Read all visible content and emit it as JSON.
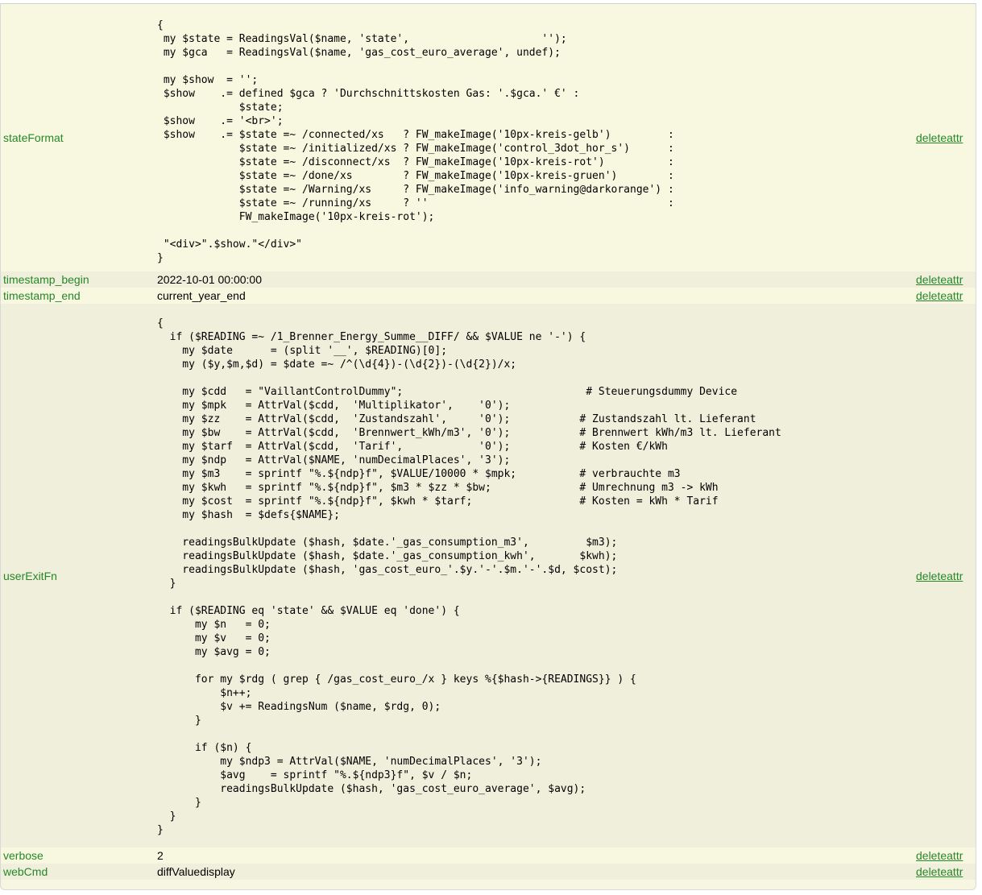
{
  "attributes": [
    {
      "name": "stateFormat",
      "action": "deleteattr",
      "code": "{\n my $state = ReadingsVal($name, 'state',                     '');\n my $gca   = ReadingsVal($name, 'gas_cost_euro_average', undef);\n\n my $show  = '';\n $show    .= defined $gca ? 'Durchschnittskosten Gas: '.$gca.' €' :\n             $state;\n $show    .= '<br>';\n $show    .= $state =~ /connected/xs   ? FW_makeImage('10px-kreis-gelb')         :\n             $state =~ /initialized/xs ? FW_makeImage('control_3dot_hor_s')      :\n             $state =~ /disconnect/xs  ? FW_makeImage('10px-kreis-rot')          :\n             $state =~ /done/xs        ? FW_makeImage('10px-kreis-gruen')        :\n             $state =~ /Warning/xs     ? FW_makeImage('info_warning@darkorange') :\n             $state =~ /running/xs     ? ''                                      :\n             FW_makeImage('10px-kreis-rot');\n\n \"<div>\".$show.\"</div>\"\n}"
    },
    {
      "name": "timestamp_begin",
      "action": "deleteattr",
      "value": "2022-10-01 00:00:00"
    },
    {
      "name": "timestamp_end",
      "action": "deleteattr",
      "value": "current_year_end"
    },
    {
      "name": "userExitFn",
      "action": "deleteattr",
      "code": "{\n  if ($READING =~ /1_Brenner_Energy_Summe__DIFF/ && $VALUE ne '-') {\n    my $date      = (split '__', $READING)[0];\n    my ($y,$m,$d) = $date =~ /^(\\d{4})-(\\d{2})-(\\d{2})/x;\n\n    my $cdd   = \"VaillantControlDummy\";                             # Steuerungsdummy Device\n    my $mpk   = AttrVal($cdd,  'Multiplikator',    '0');\n    my $zz    = AttrVal($cdd,  'Zustandszahl',     '0');           # Zustandszahl lt. Lieferant\n    my $bw    = AttrVal($cdd,  'Brennwert_kWh/m3', '0');           # Brennwert kWh/m3 lt. Lieferant\n    my $tarf  = AttrVal($cdd,  'Tarif',            '0');           # Kosten €/kWh\n    my $ndp   = AttrVal($NAME, 'numDecimalPlaces', '3');\n    my $m3    = sprintf \"%.${ndp}f\", $VALUE/10000 * $mpk;          # verbrauchte m3\n    my $kwh   = sprintf \"%.${ndp}f\", $m3 * $zz * $bw;              # Umrechnung m3 -> kWh\n    my $cost  = sprintf \"%.${ndp}f\", $kwh * $tarf;                 # Kosten = kWh * Tarif\n    my $hash  = $defs{$NAME};\n\n    readingsBulkUpdate ($hash, $date.'_gas_consumption_m3',         $m3);\n    readingsBulkUpdate ($hash, $date.'_gas_consumption_kwh',       $kwh);\n    readingsBulkUpdate ($hash, 'gas_cost_euro_'.$y.'-'.$m.'-'.$d, $cost);\n  }\n\n  if ($READING eq 'state' && $VALUE eq 'done') {\n      my $n   = 0;\n      my $v   = 0;\n      my $avg = 0;\n\n      for my $rdg ( grep { /gas_cost_euro_/x } keys %{$hash->{READINGS}} ) {\n          $n++;\n          $v += ReadingsNum ($name, $rdg, 0);\n      }\n\n      if ($n) {\n          my $ndp3 = AttrVal($NAME, 'numDecimalPlaces', '3');\n          $avg    = sprintf \"%.${ndp3}f\", $v / $n;\n          readingsBulkUpdate ($hash, 'gas_cost_euro_average', $avg);\n      }\n  }\n}"
    },
    {
      "name": "verbose",
      "action": "deleteattr",
      "value": "2"
    },
    {
      "name": "webCmd",
      "action": "deleteattr",
      "value": "diffValuedisplay"
    }
  ]
}
